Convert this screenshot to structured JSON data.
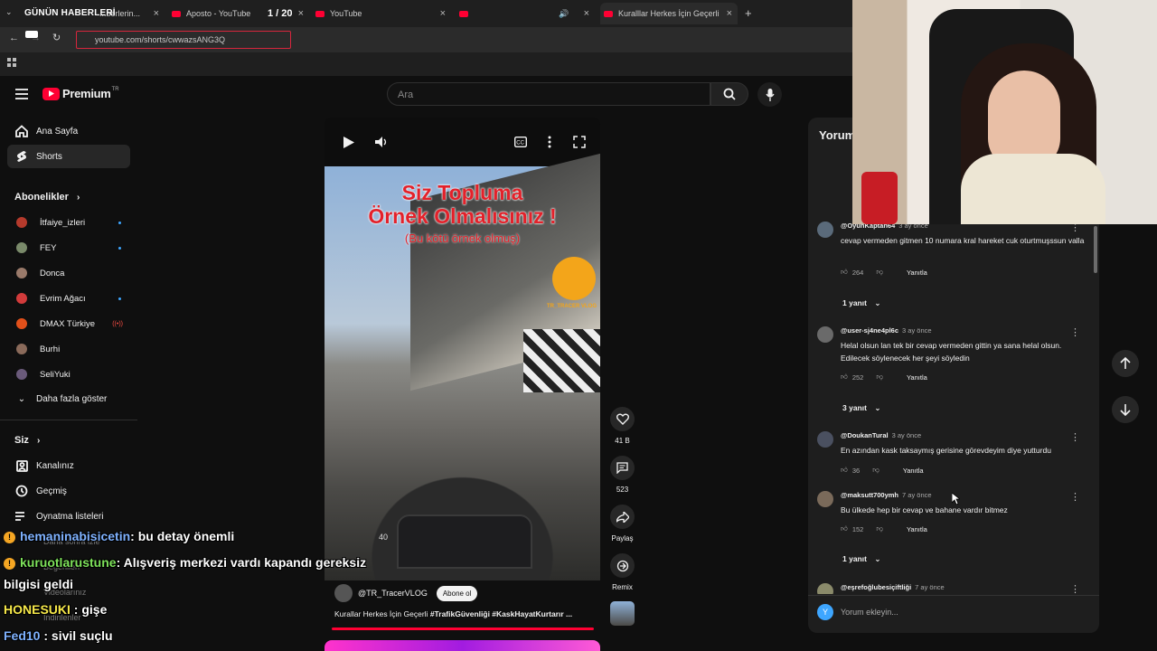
{
  "browser": {
    "brand": "GÜNÜN HABERLERİ",
    "tab_counter": "1 / 20",
    "tabs": [
      {
        "label": "...berlerin..."
      },
      {
        "label": "Aposto - YouTube"
      },
      {
        "label": "YouTube"
      },
      {
        "label": ""
      },
      {
        "label": "Kuralllar Herkes İçin Geçerli #Tr..."
      }
    ],
    "url": "youtube.com/shorts/cwwazsANG3Q"
  },
  "header": {
    "logo_label": "Premium",
    "region": "TR",
    "search_placeholder": "Ara"
  },
  "sidebar": {
    "main": [
      {
        "label": "Ana Sayfa",
        "icon": "home-icon"
      },
      {
        "label": "Shorts",
        "icon": "shorts-icon"
      }
    ],
    "subscriptions_heading": "Abonelikler",
    "subscriptions": [
      {
        "label": "İtfaiye_izleri",
        "color": "#b53a2c",
        "dot": true
      },
      {
        "label": "FEY",
        "color": "#7a8a6a",
        "dot": true
      },
      {
        "label": "Donca",
        "color": "#9a7a6a",
        "dot": false
      },
      {
        "label": "Evrim Ağacı",
        "color": "#d23b3b",
        "dot": true
      },
      {
        "label": "DMAX Türkiye",
        "color": "#e2501a",
        "live": "((•))"
      },
      {
        "label": "Burhi",
        "color": "#8a6a5a",
        "dot": false
      },
      {
        "label": "SeliYuki",
        "color": "#6a5a7a",
        "dot": false
      }
    ],
    "show_more": "Daha fazla göster",
    "you_heading": "Siz",
    "you_items": [
      {
        "label": "Kanalınız"
      },
      {
        "label": "Geçmiş"
      },
      {
        "label": "Oynatma listeleri"
      }
    ],
    "hidden_items": [
      "Daha sonra izle",
      "Beğenilen",
      "Videolarınız",
      "İndirilenler"
    ]
  },
  "video": {
    "overlay_line1": "Siz Topluma",
    "overlay_line2": "Örnek Olmalısınız !",
    "overlay_line3": "(Bu kötü örnek olmuş)",
    "badge_text": "TR_TRACER VLOG",
    "speed": "40",
    "channel": "@TR_TracerVLOG",
    "subscribe_label": "Abone ol",
    "title_plain": "Kurallar Herkes İçin Geçerli ",
    "title_tags": "#TrafikGüvenliği #KaskHayatKurtarır ...",
    "progress": 1.0
  },
  "actions": {
    "likes": "41 B",
    "comments": "523",
    "share": "Paylaş",
    "remix": "Remix"
  },
  "comments_panel": {
    "title": "Yorum",
    "items": [
      {
        "user": "@OyunKaptan64",
        "time": "3 ay önce",
        "text": "cevap vermeden gitmen 10 numara kral hareket cuk oturtmuşssun valla",
        "likes": "264",
        "reply": "Yanıtla",
        "replies": "1 yanıt"
      },
      {
        "user": "@user-sj4ne4pl6c",
        "time": "3 ay önce",
        "text": "Helal olsun lan tek bir cevap vermeden gittin ya sana helal olsun. Edilecek söylenecek her şeyi söyledin",
        "likes": "252",
        "reply": "Yanıtla",
        "replies": "3 yanıt"
      },
      {
        "user": "@DoukanTural",
        "time": "3 ay önce",
        "text": "En azından kask taksaymış gerisine görevdeyim diye yutturdu",
        "likes": "36",
        "reply": "Yanıtla",
        "replies": ""
      },
      {
        "user": "@maksutt700ymh",
        "time": "7 ay önce",
        "text": "Bu ülkede hep bir cevap ve bahane vardır bitmez",
        "likes": "152",
        "reply": "Yanıtla",
        "replies": "1 yanıt"
      },
      {
        "user": "@eşrefoğlubesiçiftliği",
        "time": "7 ay önce",
        "text": "",
        "likes": "",
        "reply": "",
        "replies": ""
      }
    ],
    "input_placeholder": "Yorum ekleyin...",
    "me_initial": "Y"
  },
  "chat": [
    {
      "user": "hemaninabisicetin",
      "color": "#7fb2ff",
      "msg": ": bu detay önemli"
    },
    {
      "user": "kuruotlarustune",
      "color": "#7ee25b",
      "msg": ": Alışveriş merkezi vardı kapandı gereksiz"
    },
    {
      "user": "",
      "color": "#ffffff",
      "msg": "bilgisi geldi"
    },
    {
      "user": "HONESUKI",
      "color": "#f6e84a",
      "msg": " : gişe"
    },
    {
      "user": "Fed10",
      "color": "#7fb2ff",
      "msg": " : sivil suçlu"
    }
  ]
}
